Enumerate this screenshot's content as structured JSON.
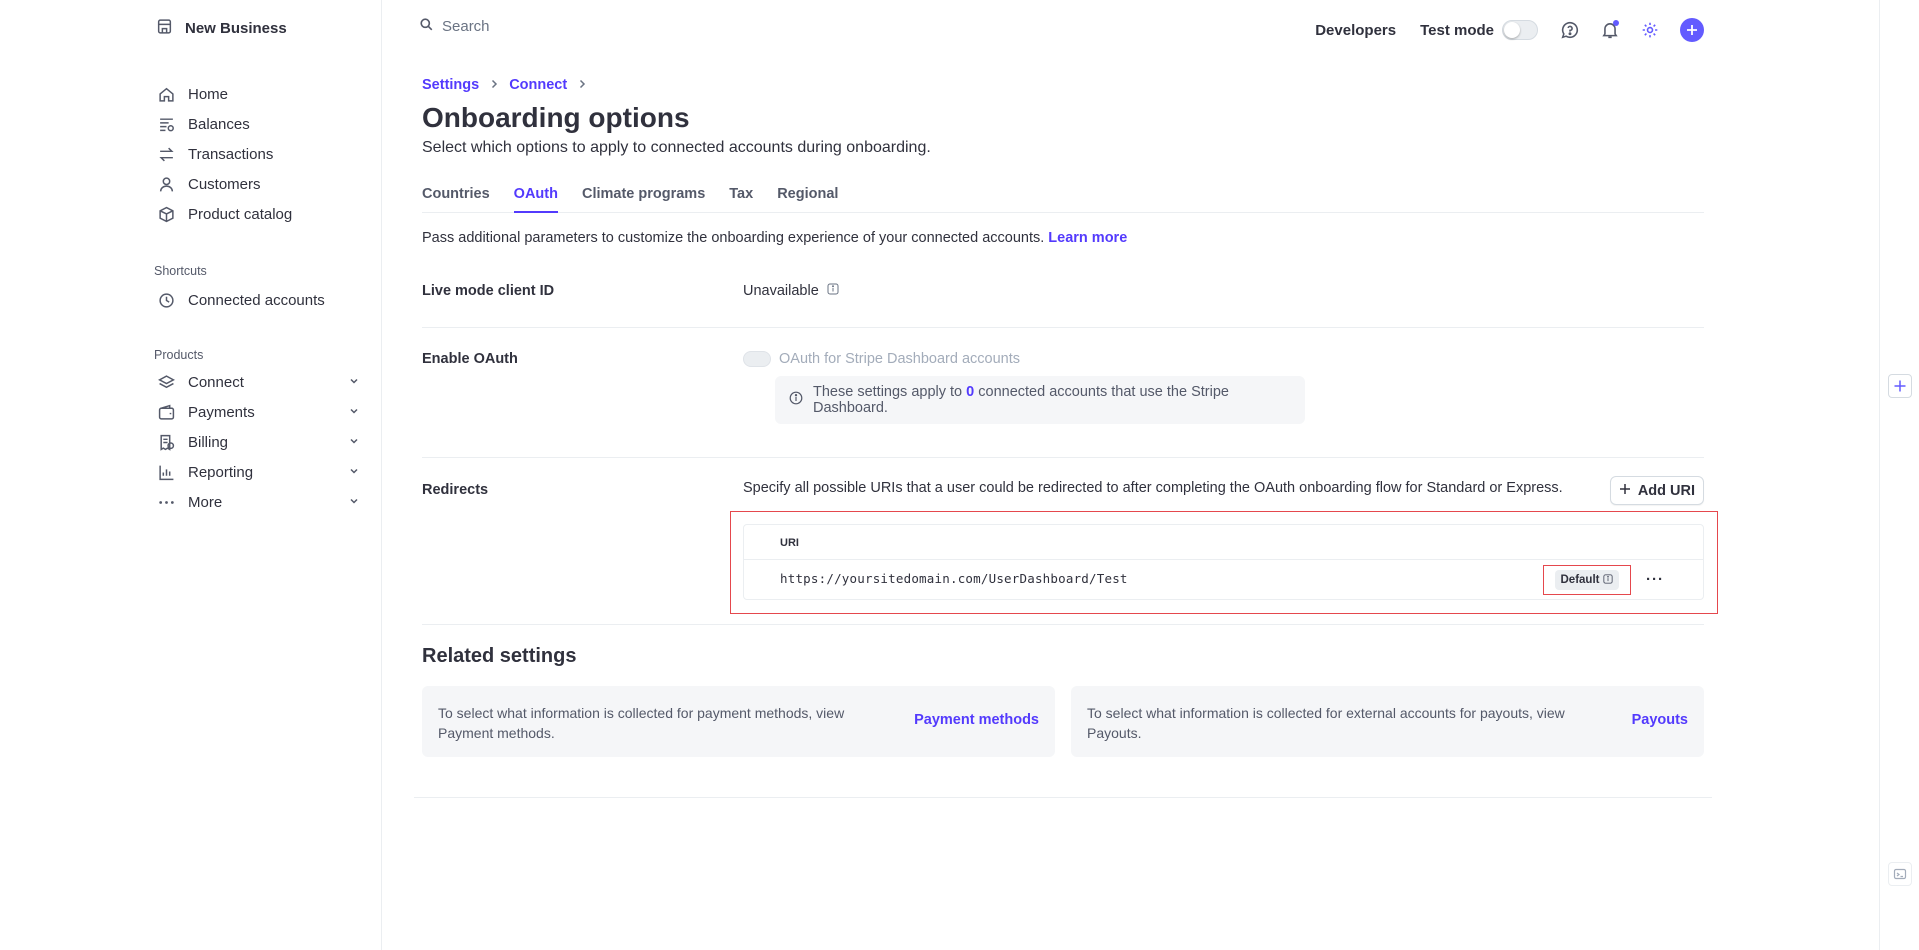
{
  "sidebar": {
    "business_name": "New Business",
    "main_items": [
      {
        "label": "Home",
        "icon": "home-icon"
      },
      {
        "label": "Balances",
        "icon": "balances-icon"
      },
      {
        "label": "Transactions",
        "icon": "transactions-icon"
      },
      {
        "label": "Customers",
        "icon": "customers-icon"
      },
      {
        "label": "Product catalog",
        "icon": "box-icon"
      }
    ],
    "shortcuts_label": "Shortcuts",
    "shortcuts": [
      {
        "label": "Connected accounts",
        "icon": "clock-icon"
      }
    ],
    "products_label": "Products",
    "products": [
      {
        "label": "Connect",
        "icon": "layers-icon"
      },
      {
        "label": "Payments",
        "icon": "wallet-icon"
      },
      {
        "label": "Billing",
        "icon": "receipt-icon"
      },
      {
        "label": "Reporting",
        "icon": "chart-icon"
      },
      {
        "label": "More",
        "icon": "dots-icon"
      }
    ]
  },
  "topbar": {
    "search_placeholder": "Search",
    "developers": "Developers",
    "test_mode": "Test mode"
  },
  "breadcrumb": [
    "Settings",
    "Connect"
  ],
  "page": {
    "title": "Onboarding options",
    "subtitle": "Select which options to apply to connected accounts during onboarding."
  },
  "tabs": [
    "Countries",
    "OAuth",
    "Climate programs",
    "Tax",
    "Regional"
  ],
  "active_tab": "OAuth",
  "oauth": {
    "description": "Pass additional parameters to customize the onboarding experience of your connected accounts.",
    "learn_more": "Learn more",
    "live_client_id_label": "Live mode client ID",
    "live_client_id_value": "Unavailable",
    "enable_oauth_label": "Enable OAuth",
    "enable_oauth_toggle_label": "OAuth for Stripe Dashboard accounts",
    "note_before": "These settings apply to",
    "note_count": "0",
    "note_after": "connected accounts that use the Stripe Dashboard.",
    "redirects_label": "Redirects",
    "redirects_description": "Specify all possible URIs that a user could be redirected to after completing the OAuth onboarding flow for Standard or Express.",
    "add_uri": "Add URI",
    "uri_column": "URI",
    "uris": [
      {
        "value": "https://yoursitedomain.com/UserDashboard/Test",
        "badge": "Default"
      }
    ],
    "more_actions": "···"
  },
  "related": {
    "title": "Related settings",
    "cards": [
      {
        "text": "To select what information is collected for payment methods, view Payment methods.",
        "link": "Payment methods"
      },
      {
        "text": "To select what information is collected for external accounts for payouts, view Payouts.",
        "link": "Payouts"
      }
    ]
  },
  "colors": {
    "accent": "#533afd",
    "highlight": "#e5484d",
    "text": "#30313d"
  }
}
